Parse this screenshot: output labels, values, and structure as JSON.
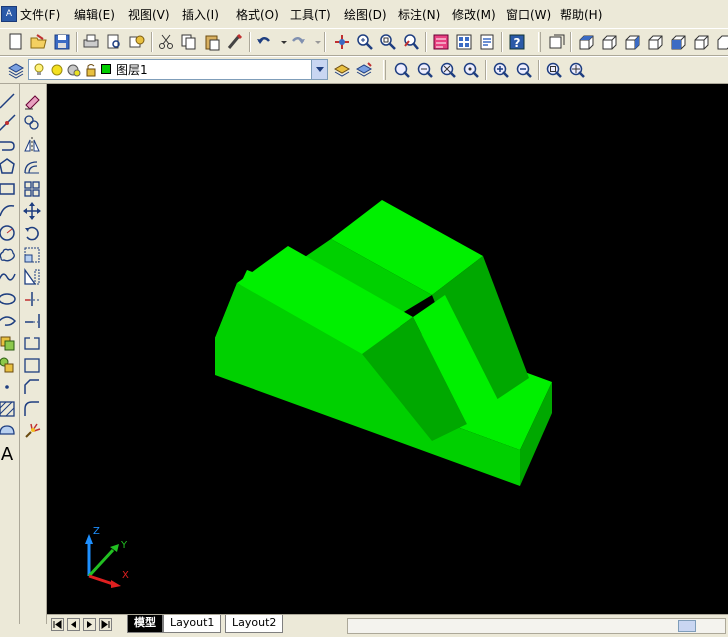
{
  "menu": {
    "items": [
      "文件(F)",
      "编辑(E)",
      "视图(V)",
      "插入(I)",
      "格式(O)",
      "工具(T)",
      "绘图(D)",
      "标注(N)",
      "修改(M)",
      "窗口(W)",
      "帮助(H)"
    ]
  },
  "layer_toolbar": {
    "current_layer": "图层1",
    "layer_color": "#00CC00"
  },
  "tabs": {
    "model": "模型",
    "layout1": "Layout1",
    "layout2": "Layout2"
  },
  "ucs": {
    "x_label": "X",
    "y_label": "Y",
    "z_label": "Z"
  },
  "model_colors": {
    "top": "#00F000",
    "front": "#00D000",
    "side": "#00A800"
  },
  "canvas_background": "#000000"
}
